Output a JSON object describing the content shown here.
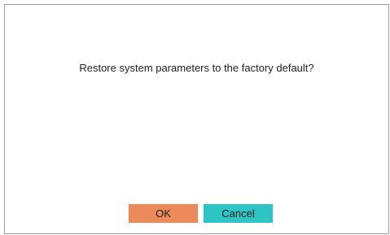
{
  "dialog": {
    "message": "Restore system parameters to the factory default?",
    "ok_label": "OK",
    "cancel_label": "Cancel"
  },
  "colors": {
    "ok_button": "#ec8a5c",
    "cancel_button": "#2fc4c4",
    "border": "#9c9c9c"
  }
}
